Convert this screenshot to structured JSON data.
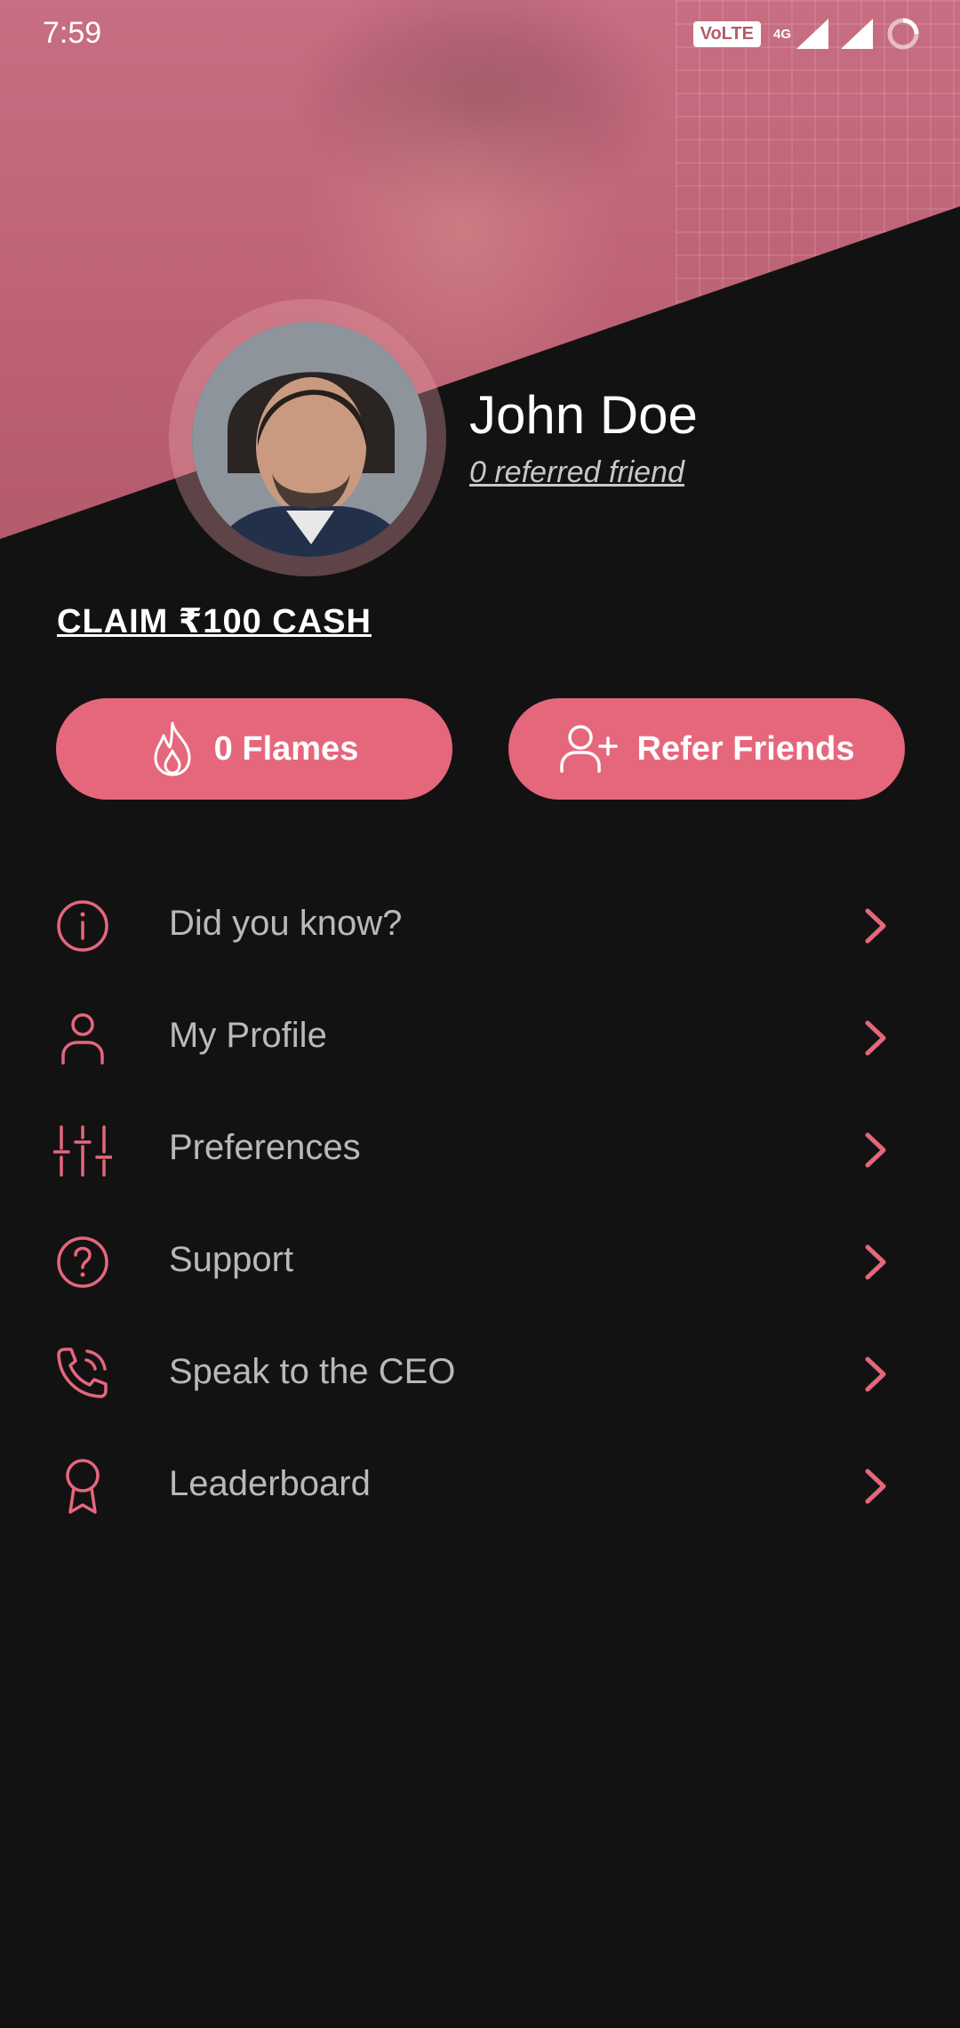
{
  "status_bar": {
    "time": "7:59",
    "volte_label": "VoLTE",
    "network_label": "4G"
  },
  "profile": {
    "name": "John Doe",
    "referred_text": "0 referred friend"
  },
  "claim_label": "CLAIM ₹100 CASH",
  "buttons": {
    "flames": {
      "label": "0 Flames",
      "icon": "flame-icon"
    },
    "refer": {
      "label": "Refer Friends",
      "icon": "user-plus-icon"
    }
  },
  "menu": {
    "items": [
      {
        "label": "Did you know?",
        "icon": "info-icon"
      },
      {
        "label": "My Profile",
        "icon": "user-icon"
      },
      {
        "label": "Preferences",
        "icon": "sliders-icon"
      },
      {
        "label": "Support",
        "icon": "help-circle-icon"
      },
      {
        "label": "Speak to the CEO",
        "icon": "phone-call-icon"
      },
      {
        "label": "Leaderboard",
        "icon": "award-icon"
      }
    ]
  },
  "colors": {
    "accent": "#e5677c",
    "background": "#131213",
    "header_tint": "#c86e82",
    "menu_text": "#b9b9b9"
  }
}
